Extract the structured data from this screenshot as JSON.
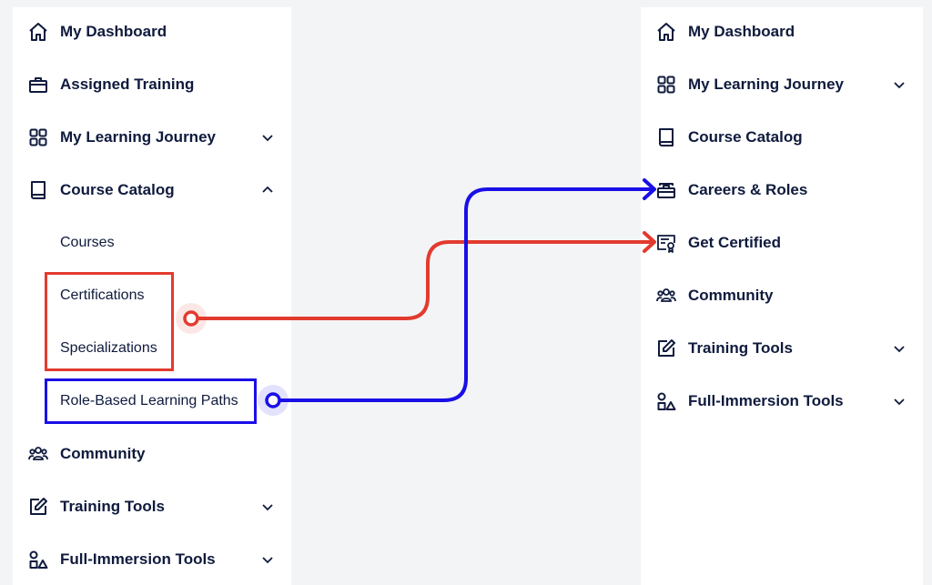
{
  "colors": {
    "text": "#0f1a3d",
    "red_highlight": "#e23b2e",
    "blue_highlight": "#1a0fe6",
    "background": "#f3f4f6",
    "panel": "#ffffff"
  },
  "left_nav": {
    "items": [
      {
        "label": "My Dashboard",
        "icon": "home-icon"
      },
      {
        "label": "Assigned Training",
        "icon": "briefcase-icon"
      },
      {
        "label": "My Learning Journey",
        "icon": "grid-icon",
        "chevron": "down"
      },
      {
        "label": "Course Catalog",
        "icon": "book-icon",
        "chevron": "up"
      },
      {
        "label": "Community",
        "icon": "people-icon"
      },
      {
        "label": "Training Tools",
        "icon": "edit-icon",
        "chevron": "down"
      },
      {
        "label": "Full-Immersion Tools",
        "icon": "shapes-icon",
        "chevron": "down"
      }
    ],
    "sub_items": [
      {
        "label": "Courses"
      },
      {
        "label": "Certifications"
      },
      {
        "label": "Specializations"
      },
      {
        "label": "Role-Based Learning Paths"
      }
    ]
  },
  "right_nav": {
    "items": [
      {
        "label": "My Dashboard",
        "icon": "home-icon"
      },
      {
        "label": "My Learning Journey",
        "icon": "grid-icon",
        "chevron": "down"
      },
      {
        "label": "Course Catalog",
        "icon": "book-icon"
      },
      {
        "label": "Careers & Roles",
        "icon": "briefcase-stack-icon"
      },
      {
        "label": "Get Certified",
        "icon": "certificate-icon"
      },
      {
        "label": "Community",
        "icon": "people-icon"
      },
      {
        "label": "Training Tools",
        "icon": "edit-icon",
        "chevron": "down"
      },
      {
        "label": "Full-Immersion Tools",
        "icon": "shapes-icon",
        "chevron": "down"
      }
    ]
  },
  "mappings": [
    {
      "from": "Certifications + Specializations",
      "to": "Get Certified",
      "color": "#e23b2e"
    },
    {
      "from": "Role-Based Learning Paths",
      "to": "Careers & Roles",
      "color": "#1a0fe6"
    }
  ]
}
